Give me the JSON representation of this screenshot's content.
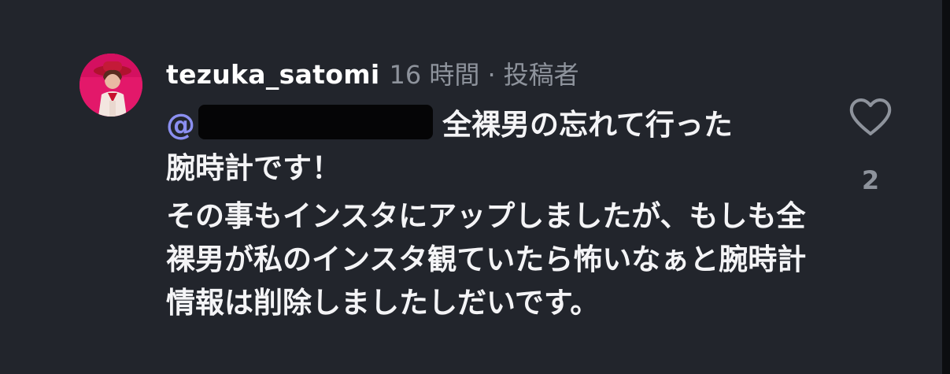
{
  "comment": {
    "username": "tezuka_satomi",
    "time": "16 時間",
    "separator": "·",
    "role_badge": "投稿者",
    "mention_prefix": "@",
    "line1_after_mention": "全裸男の忘れて行った",
    "line2": "腕時計です！",
    "paragraph2": "その事もインスタにアップしましたが、もしも全裸男が私のインスタ観ていたら怖いなぁと腕時計情報は削除しましたしだいです。",
    "like_icon": "heart-icon",
    "like_count": "2"
  },
  "colors": {
    "background": "#22252c",
    "username": "#ffffff",
    "meta": "#8e939c",
    "mention": "#8b8ff0",
    "avatar_bg": "#e3186a"
  }
}
